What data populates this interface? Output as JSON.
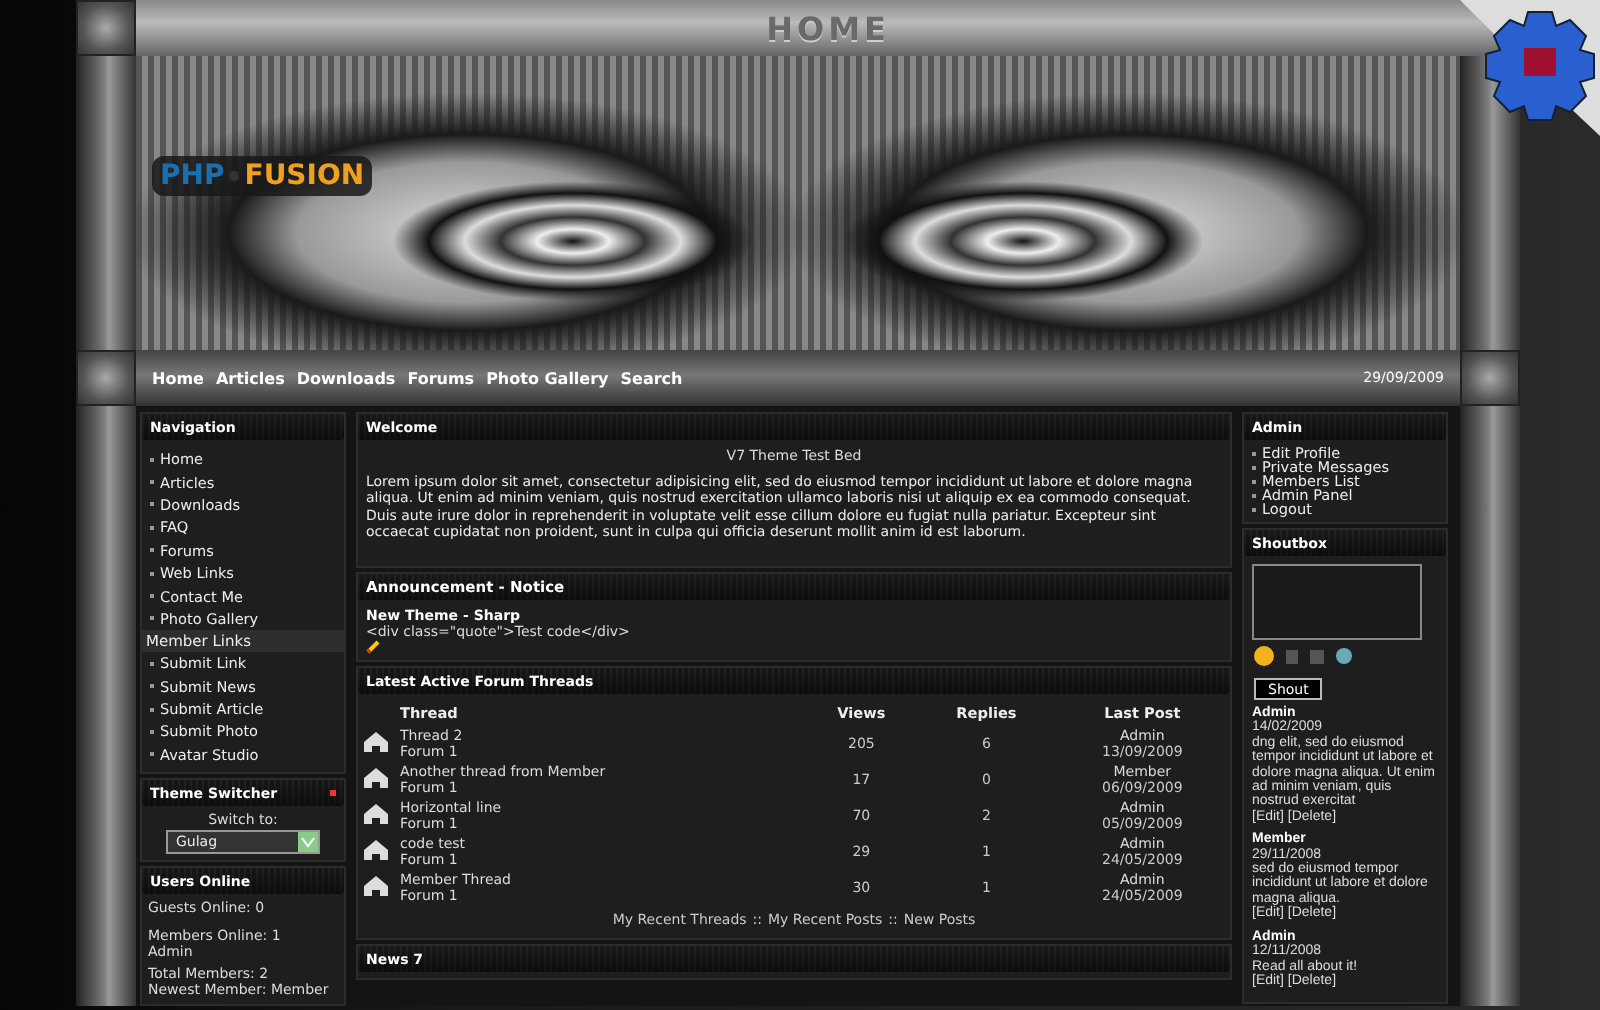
{
  "header": {
    "title": "HOME",
    "logo": {
      "left": "PHP",
      "right": "FUSION"
    }
  },
  "nav": {
    "links": [
      "Home",
      "Articles",
      "Downloads",
      "Forums",
      "Photo Gallery",
      "Search"
    ],
    "date": "29/09/2009"
  },
  "left": {
    "navigation": {
      "title": "Navigation",
      "items": [
        {
          "kind": "link",
          "label": "Home"
        },
        {
          "kind": "link",
          "label": "Articles"
        },
        {
          "kind": "link",
          "label": "Downloads"
        },
        {
          "kind": "link",
          "label": "FAQ"
        },
        {
          "kind": "link",
          "label": "Forums"
        },
        {
          "kind": "link",
          "label": "Web Links"
        },
        {
          "kind": "link",
          "label": "Contact Me"
        },
        {
          "kind": "link",
          "label": "Photo Gallery"
        },
        {
          "kind": "heading",
          "label": "Member Links"
        },
        {
          "kind": "link",
          "label": "Submit Link"
        },
        {
          "kind": "link",
          "label": "Submit News"
        },
        {
          "kind": "link",
          "label": "Submit Article"
        },
        {
          "kind": "link",
          "label": "Submit Photo"
        },
        {
          "kind": "link",
          "label": "Avatar Studio"
        }
      ]
    },
    "theme_switcher": {
      "title": "Theme Switcher",
      "label": "Switch to:",
      "value": "Gulag"
    },
    "users_online": {
      "title": "Users Online",
      "guests": "Guests Online: 0",
      "members": "Members Online: 1",
      "member_names": "Admin",
      "total": "Total Members: 2",
      "newest": "Newest Member: Member"
    }
  },
  "center": {
    "welcome": {
      "title": "Welcome",
      "subtitle": "V7 Theme Test Bed",
      "body": "Lorem ipsum dolor sit amet, consectetur adipisicing elit, sed do eiusmod tempor incididunt ut labore et dolore magna aliqua. Ut enim ad minim veniam, quis nostrud exercitation ullamco laboris nisi ut aliquip ex ea commodo consequat. Duis aute irure dolor in reprehenderit in voluptate velit esse cillum dolore eu fugiat nulla pariatur. Excepteur sint occaecat cupidatat non proident, sunt in culpa qui officia deserunt mollit anim id est laborum."
    },
    "announcement": {
      "title": "Announcement - Notice",
      "heading": "New Theme - Sharp",
      "code": "<div class=\"quote\">Test code</div>"
    },
    "threads": {
      "title": "Latest Active Forum Threads",
      "columns": [
        "Thread",
        "Views",
        "Replies",
        "Last Post"
      ],
      "rows": [
        {
          "thread": "Thread 2",
          "forum": "Forum 1",
          "views": "205",
          "replies": "6",
          "user": "Admin",
          "date": "13/09/2009"
        },
        {
          "thread": "Another thread from Member",
          "forum": "Forum 1",
          "views": "17",
          "replies": "0",
          "user": "Member",
          "date": "06/09/2009"
        },
        {
          "thread": "Horizontal line",
          "forum": "Forum 1",
          "views": "70",
          "replies": "2",
          "user": "Admin",
          "date": "05/09/2009"
        },
        {
          "thread": "code test",
          "forum": "Forum 1",
          "views": "29",
          "replies": "1",
          "user": "Admin",
          "date": "24/05/2009"
        },
        {
          "thread": "Member Thread",
          "forum": "Forum 1",
          "views": "30",
          "replies": "1",
          "user": "Admin",
          "date": "24/05/2009"
        }
      ],
      "footer_links": [
        "My Recent Threads",
        "My Recent Posts",
        "New Posts"
      ],
      "separator": "::"
    },
    "news": {
      "title": "News 7"
    }
  },
  "right": {
    "admin": {
      "title": "Admin",
      "items": [
        "Edit Profile",
        "Private Messages",
        "Members List",
        "Admin Panel",
        "Logout"
      ]
    },
    "shoutbox": {
      "title": "Shoutbox",
      "button": "Shout",
      "posts": [
        {
          "user": "Admin",
          "date": "14/02/2009",
          "text": "dng elit, sed do eiusmod tempor incididunt ut labore et dolore magna aliqua. Ut enim ad minim veniam, quis nostrud exercitat",
          "actions": "[Edit] [Delete]"
        },
        {
          "user": "Member",
          "date": "29/11/2008",
          "text": "sed do eiusmod tempor incididunt ut labore et dolore magna aliqua.",
          "actions": "[Edit] [Delete]"
        },
        {
          "user": "Admin",
          "date": "12/11/2008",
          "text": "Read all about it!",
          "actions": "[Edit] [Delete]"
        }
      ]
    }
  }
}
